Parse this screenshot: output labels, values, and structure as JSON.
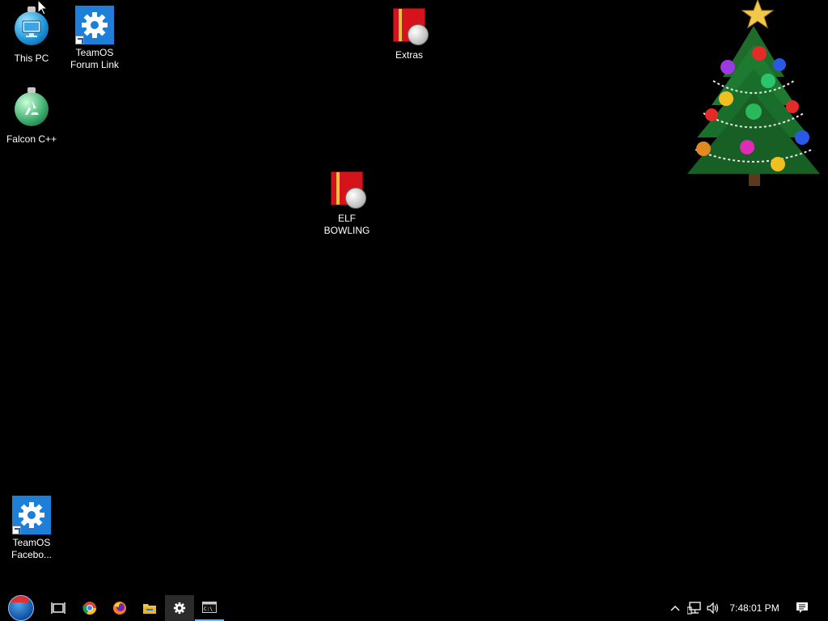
{
  "desktop": {
    "icons": [
      {
        "name": "desktop-icon-this-pc",
        "label": "This PC",
        "icon": "monitor-ornament-icon"
      },
      {
        "name": "desktop-icon-teamos-forum",
        "label": "TeamOS\nForum Link",
        "icon": "settings-gear-icon"
      },
      {
        "name": "desktop-icon-extras",
        "label": "Extras",
        "icon": "gift-box-icon"
      },
      {
        "name": "desktop-icon-falcon-cpp",
        "label": "Falcon C++",
        "icon": "recycle-ornament-icon"
      },
      {
        "name": "desktop-icon-elf-bowling",
        "label": "ELF BOWLING",
        "icon": "gift-box-icon"
      },
      {
        "name": "desktop-icon-teamos-facebook",
        "label": "TeamOS\nFacebo...",
        "icon": "settings-gear-icon"
      }
    ],
    "decoration": "christmas-tree-icon"
  },
  "taskbar": {
    "start": "start-orb-icon",
    "pinned": [
      {
        "name": "task-view",
        "icon": "task-view-icon"
      },
      {
        "name": "chrome",
        "icon": "chrome-icon"
      },
      {
        "name": "firefox",
        "icon": "firefox-icon"
      },
      {
        "name": "file-explorer",
        "icon": "folder-icon"
      },
      {
        "name": "settings",
        "icon": "gear-icon",
        "state": "active"
      },
      {
        "name": "command-prompt",
        "icon": "terminal-icon",
        "state": "running"
      }
    ],
    "tray": {
      "overflow_icon": "chevron-up-icon",
      "network_icon": "network-icon",
      "volume_icon": "volume-icon",
      "time": "7:48:01 PM",
      "notifications_icon": "action-center-icon"
    }
  },
  "colors": {
    "background": "#000000",
    "settings_tile": "#1e7fd8",
    "running_indicator": "#78b0e6"
  }
}
